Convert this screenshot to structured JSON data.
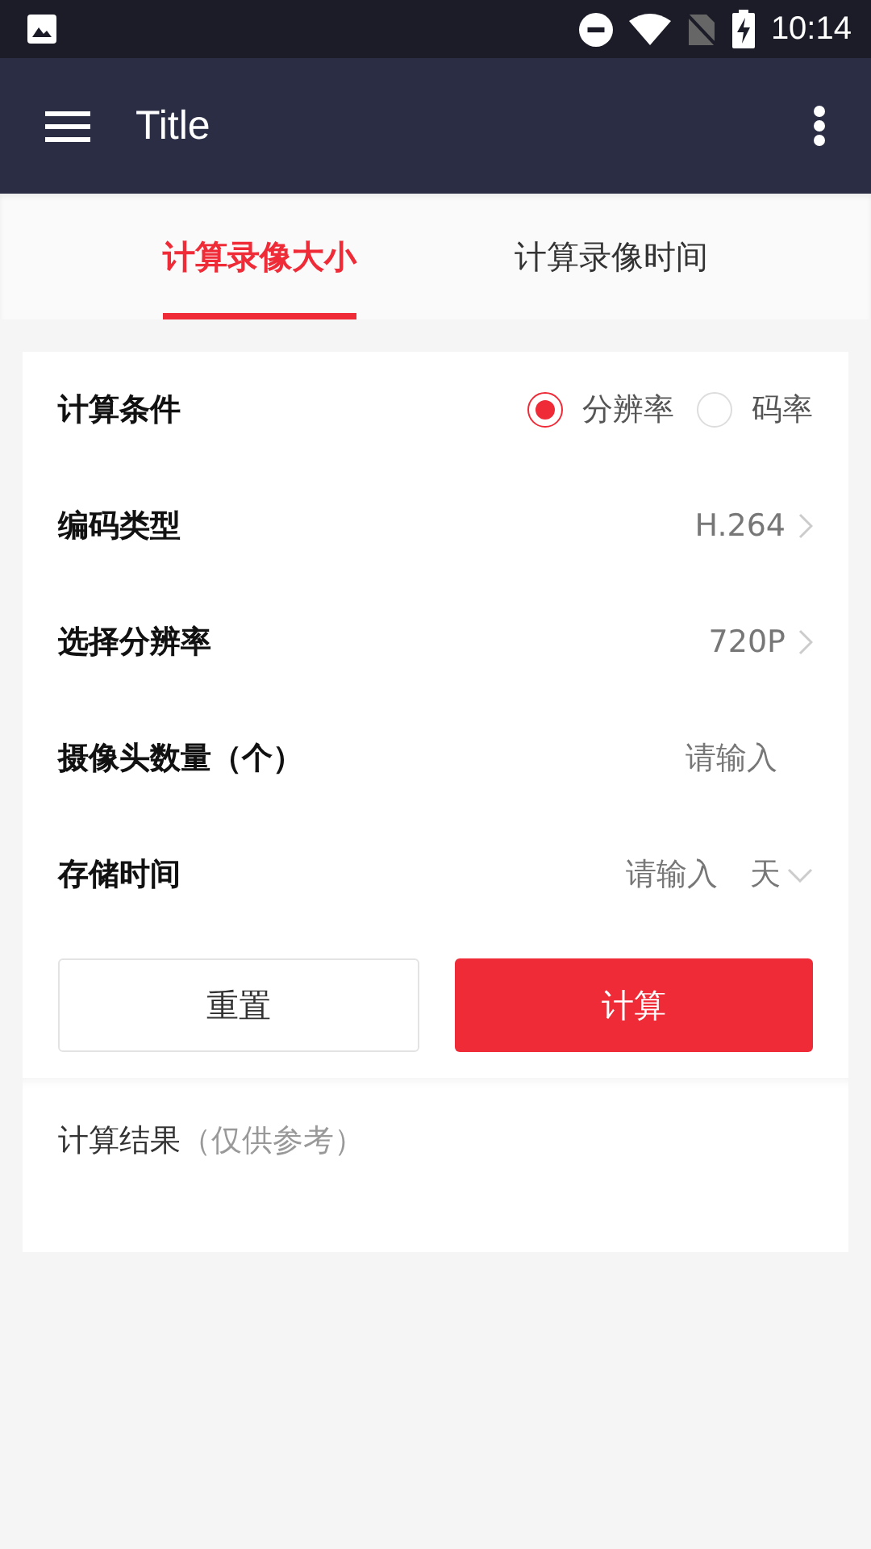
{
  "status_bar": {
    "time": "10:14"
  },
  "app_bar": {
    "title": "Title"
  },
  "tabs": [
    {
      "label": "计算录像大小",
      "selected": true
    },
    {
      "label": "计算录像时间",
      "selected": false
    }
  ],
  "form": {
    "rows": [
      {
        "kind": "radio",
        "label": "计算条件",
        "options": [
          {
            "label": "分辨率",
            "selected": true
          },
          {
            "label": "码率",
            "selected": false
          }
        ]
      },
      {
        "kind": "select",
        "label": "编码类型",
        "value": "H.264"
      },
      {
        "kind": "select",
        "label": "选择分辨率",
        "value": "720P"
      },
      {
        "kind": "input",
        "label": "摄像头数量（个）",
        "placeholder": "请输入"
      },
      {
        "kind": "input_unit",
        "label": "存储时间",
        "placeholder": "请输入",
        "unit": "天"
      }
    ],
    "buttons": [
      {
        "label": "重置",
        "kind": "secondary"
      },
      {
        "label": "计算",
        "kind": "primary"
      }
    ]
  },
  "result": {
    "title": "计算结果",
    "note": "（仅供参考）"
  }
}
